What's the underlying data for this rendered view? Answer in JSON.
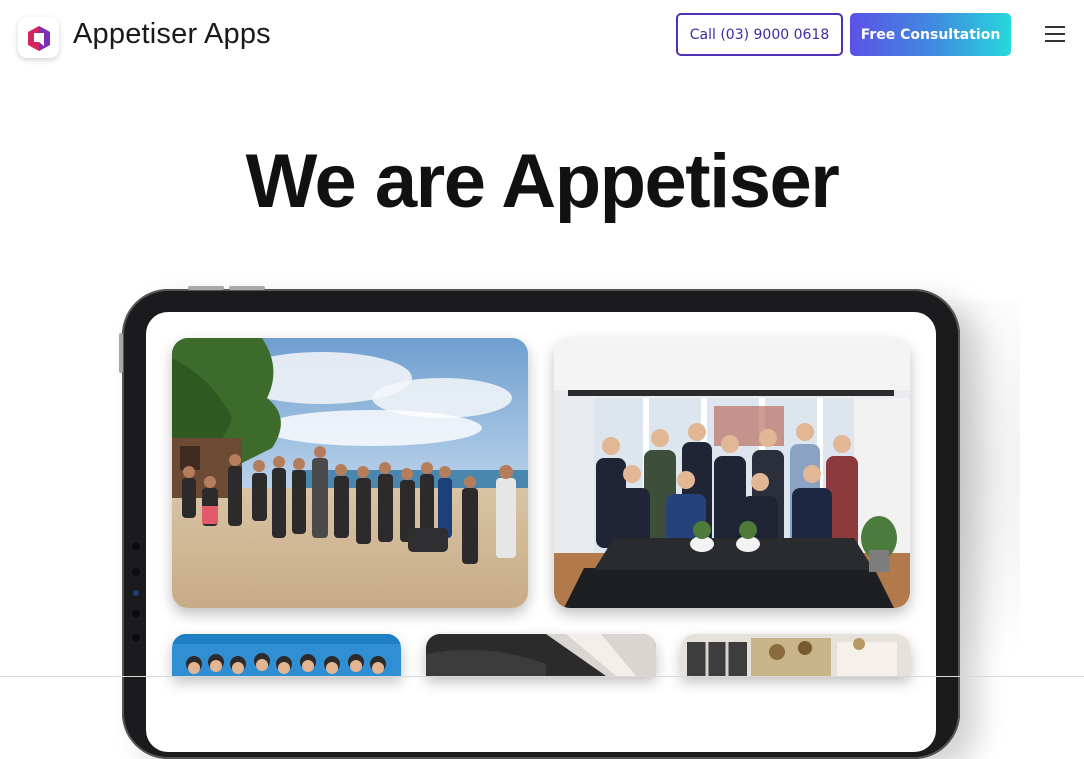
{
  "header": {
    "brand_name": "Appetiser Apps",
    "logo_icon": "appetiser-logo-icon",
    "call_label": "Call (03) 9000 0618",
    "consult_label": "Free Consultation",
    "menu_icon": "hamburger-menu-icon"
  },
  "hero": {
    "title": "We are Appetiser"
  },
  "gallery": {
    "photos": [
      {
        "name": "team-beach-photo"
      },
      {
        "name": "team-office-photo"
      },
      {
        "name": "team-blue-photo"
      },
      {
        "name": "team-dark-photo"
      },
      {
        "name": "team-room-photo"
      }
    ]
  },
  "colors": {
    "accent_purple": "#4f30b6",
    "gradient_start": "#5b52e6",
    "gradient_end": "#27d8dc"
  }
}
